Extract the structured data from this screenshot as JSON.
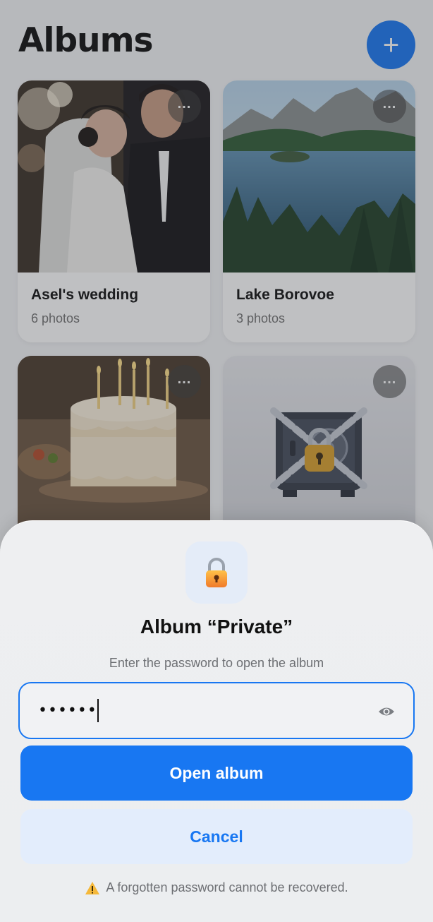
{
  "header": {
    "title": "Albums",
    "add_label": "+"
  },
  "albums": [
    {
      "name": "Asel's wedding",
      "count": "6 photos"
    },
    {
      "name": "Lake Borovoe",
      "count": "3 photos"
    },
    {
      "name": "",
      "count": ""
    },
    {
      "name": "",
      "count": ""
    }
  ],
  "more_label": "...",
  "dialog": {
    "title": "Album “Private”",
    "subtitle": "Enter the password to open the album",
    "password_value": "••••••",
    "open_label": "Open album",
    "cancel_label": "Cancel",
    "warning": "A forgotten password cannot be recovered."
  },
  "icons": {
    "add": "plus-icon",
    "more": "more-horizontal-icon",
    "lock": "padlock-icon",
    "eye": "eye-icon",
    "warning": "warning-triangle-icon",
    "safe": "chained-safe-icon"
  },
  "colors": {
    "accent": "#1877f2",
    "cancel_bg": "#e3edfc",
    "sheet_bg": "#eeeff1"
  }
}
